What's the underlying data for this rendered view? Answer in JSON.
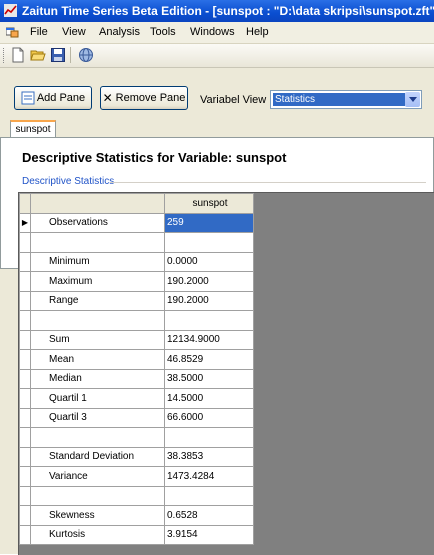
{
  "window": {
    "title": "Zaitun Time Series Beta Edition - [sunspot : \"D:\\data skripsi\\sunspot.zft\"]"
  },
  "menu": [
    "File",
    "View",
    "Analysis",
    "Tools",
    "Windows",
    "Help"
  ],
  "toolbar": {
    "icons": [
      "new-file-icon",
      "open-folder-icon",
      "save-disk-icon",
      "globe-icon"
    ]
  },
  "panel": {
    "add_pane_label": "Add Pane",
    "remove_pane_label": "Remove Pane",
    "variabel_view_label": "Variabel View :",
    "variabel_view_value": "Statistics"
  },
  "tab": {
    "label": "sunspot"
  },
  "heading": "Descriptive Statistics for Variable:   sunspot",
  "group_label": "Descriptive Statistics",
  "grid": {
    "column_header": "sunspot",
    "rows": [
      {
        "name": "Observations",
        "value": "259"
      },
      {
        "name": "",
        "value": ""
      },
      {
        "name": "Minimum",
        "value": "0.0000"
      },
      {
        "name": "Maximum",
        "value": "190.2000"
      },
      {
        "name": "Range",
        "value": "190.2000"
      },
      {
        "name": "",
        "value": ""
      },
      {
        "name": "Sum",
        "value": "12134.9000"
      },
      {
        "name": "Mean",
        "value": "46.8529"
      },
      {
        "name": "Median",
        "value": "38.5000"
      },
      {
        "name": "Quartil 1",
        "value": "14.5000"
      },
      {
        "name": "Quartil 3",
        "value": "66.6000"
      },
      {
        "name": "",
        "value": ""
      },
      {
        "name": "Standard Deviation",
        "value": "38.3853"
      },
      {
        "name": "Variance",
        "value": "1473.4284"
      },
      {
        "name": "",
        "value": ""
      },
      {
        "name": "Skewness",
        "value": "0.6528"
      },
      {
        "name": "Kurtosis",
        "value": "3.9154"
      }
    ]
  },
  "colors": {
    "titlebar": "#0a4ed0",
    "selection": "#316ac5",
    "tab_accent": "#f8a64c",
    "group_label": "#2154c8"
  }
}
